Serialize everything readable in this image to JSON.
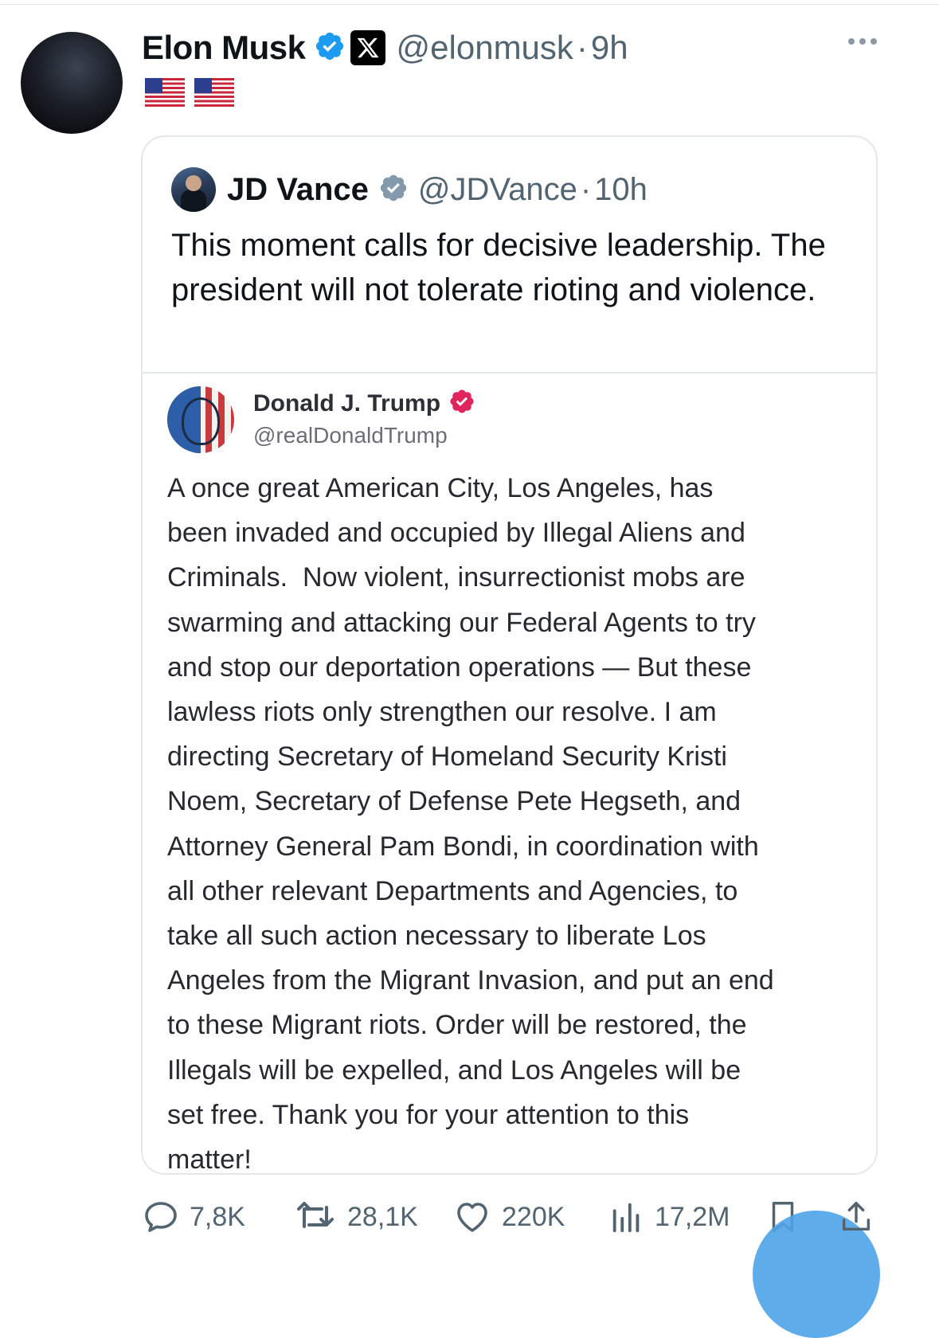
{
  "tweet": {
    "author_name": "Elon Musk",
    "handle": "@elonmusk",
    "separator": "·",
    "time": "9h",
    "flags": [
      "🇺🇸",
      "🇺🇸"
    ],
    "verified_icon": "verified-badge-blue",
    "affiliation_icon": "x-logo"
  },
  "quote": {
    "author_name": "JD Vance",
    "handle": "@JDVance",
    "separator": "·",
    "time": "10h",
    "text": "This moment calls for decisive leadership. The president will not tolerate rioting and violence.",
    "verified_icon": "verified-badge-gray"
  },
  "embedded_post": {
    "author_name": "Donald J. Trump",
    "handle": "@realDonaldTrump",
    "verified_icon": "verified-badge-red",
    "lines": [
      "A once great American City, Los Angeles, has",
      "been invaded and occupied by Illegal Aliens and",
      "Criminals.  Now violent, insurrectionist mobs are",
      "swarming and attacking our Federal Agents to try",
      "and stop our deportation operations — But these",
      "lawless riots only strengthen our resolve. I am",
      "directing Secretary of Homeland Security Kristi",
      "Noem, Secretary of Defense Pete Hegseth, and",
      "Attorney General Pam Bondi, in coordination with",
      "all other relevant Departments and Agencies, to",
      "take all such action necessary to liberate Los",
      "Angeles from the Migrant Invasion, and put an end",
      "to these Migrant riots. Order will be restored, the",
      "Illegals will be expelled, and Los Angeles will be",
      "set free. Thank you for your attention to this",
      "matter!"
    ]
  },
  "actions": {
    "replies": "7,8K",
    "reposts": "28,1K",
    "likes": "220K",
    "views": "17,2M"
  },
  "colors": {
    "verified_blue": "#1d9bf0",
    "muted_text": "#536471",
    "border": "#e4e8eb",
    "trump_badge": "#e0245e"
  }
}
